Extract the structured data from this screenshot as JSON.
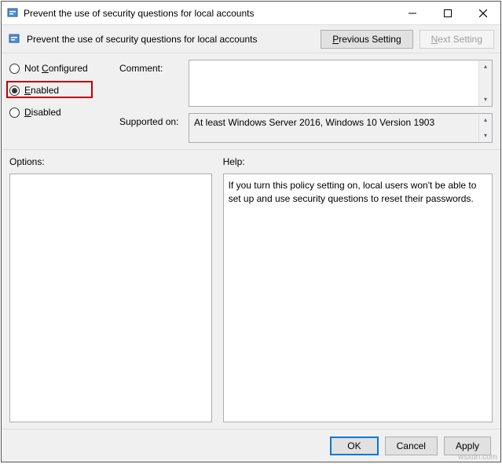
{
  "window": {
    "title": "Prevent the use of security questions for local accounts",
    "toolbar_title": "Prevent the use of security questions for local accounts",
    "prev_button": "Previous Setting",
    "next_button": "Next Setting"
  },
  "radios": {
    "not_configured": "Not Configured",
    "enabled": "Enabled",
    "disabled": "Disabled",
    "selected": "enabled"
  },
  "form": {
    "comment_label": "Comment:",
    "comment_value": "",
    "supported_label": "Supported on:",
    "supported_value": "At least Windows Server 2016, Windows 10 Version 1903"
  },
  "sections": {
    "options_label": "Options:",
    "options_value": "",
    "help_label": "Help:",
    "help_value": "If you turn this policy setting on, local users won't be able to set up and use security questions to reset their passwords."
  },
  "footer": {
    "ok": "OK",
    "cancel": "Cancel",
    "apply": "Apply"
  },
  "watermark": "wsxdn.com"
}
